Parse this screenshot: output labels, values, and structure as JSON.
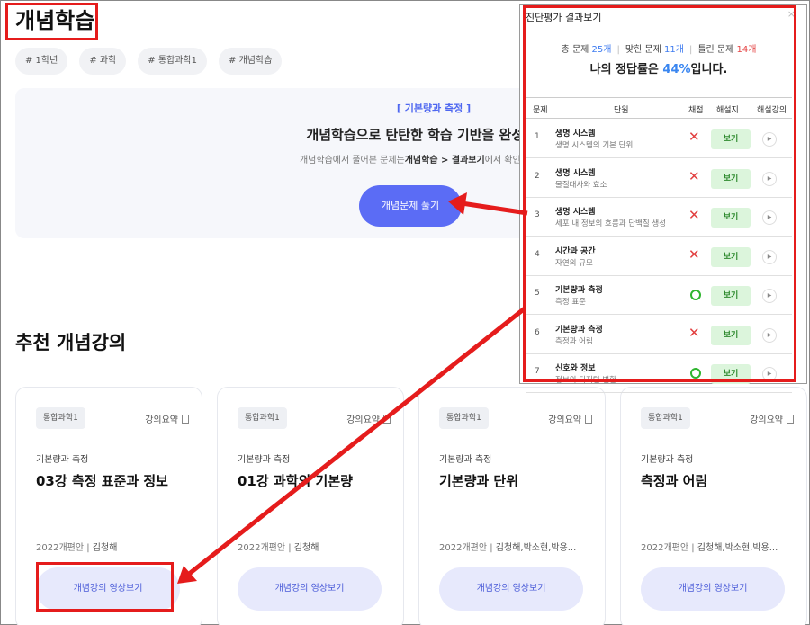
{
  "page": {
    "title": "개념학습"
  },
  "tags": [
    "# 1학년",
    "# 과학",
    "# 통합과학1",
    "# 개념학습"
  ],
  "hero": {
    "category": "[ 기본량과 측정 ]",
    "headline": "개념학습으로 탄탄한 학습 기반을 완성하세요",
    "sub_prefix": "개념학습에서 풀어본 문제는",
    "sub_bold": "개념학습 > 결과보기",
    "sub_suffix": "에서 확인 가능합니다.",
    "button": "개념문제 풀기"
  },
  "section": {
    "title": "추천 개념강의"
  },
  "cards": [
    {
      "chip": "통합과학1",
      "summary": "강의요약",
      "category": "기본량과 측정",
      "title": "03강 측정 표준과 정보",
      "edition": "2022개편안",
      "author": "김청해",
      "button": "개념강의 영상보기"
    },
    {
      "chip": "통합과학1",
      "summary": "강의요약",
      "category": "기본량과 측정",
      "title": "01강 과학의 기본량",
      "edition": "2022개편안",
      "author": "김청해",
      "button": "개념강의 영상보기"
    },
    {
      "chip": "통합과학1",
      "summary": "강의요약",
      "category": "기본량과 측정",
      "title": "기본량과 단위",
      "edition": "2022개편안",
      "author": "김청해,박소현,박용...",
      "button": "개념강의 영상보기"
    },
    {
      "chip": "통합과학1",
      "summary": "강의요약",
      "category": "기본량과 측정",
      "title": "측정과 어림",
      "edition": "2022개편안",
      "author": "김청해,박소현,박용...",
      "button": "개념강의 영상보기"
    }
  ],
  "panel": {
    "title": "진단평가 결과보기",
    "close": "×",
    "total_label": "총 문제",
    "total_value": "25개",
    "correct_label": "맞힌 문제",
    "correct_value": "11개",
    "wrong_label": "틀린 문제",
    "wrong_value": "14개",
    "rate_prefix": "나의 정답률은 ",
    "rate_value": "44%",
    "rate_suffix": "입니다.",
    "headers": [
      "문제",
      "단원",
      "채점",
      "해설지",
      "해설강의"
    ],
    "rows": [
      {
        "num": "1",
        "unit": "생명 시스템",
        "sub": "생명 시스템의 기본 단위",
        "result": "wrong",
        "button": "보기"
      },
      {
        "num": "2",
        "unit": "생명 시스템",
        "sub": "물질대사와 효소",
        "result": "wrong",
        "button": "보기"
      },
      {
        "num": "3",
        "unit": "생명 시스템",
        "sub": "세포 내 정보의 흐름과 단백질 생성",
        "result": "wrong",
        "button": "보기"
      },
      {
        "num": "4",
        "unit": "시간과 공간",
        "sub": "자연의 규모",
        "result": "wrong",
        "button": "보기"
      },
      {
        "num": "5",
        "unit": "기본량과 측정",
        "sub": "측정 표준",
        "result": "correct",
        "button": "보기"
      },
      {
        "num": "6",
        "unit": "기본량과 측정",
        "sub": "측정과 어림",
        "result": "wrong",
        "button": "보기"
      },
      {
        "num": "7",
        "unit": "신호와 정보",
        "sub": "정보의 디지털 변환",
        "result": "correct",
        "button": "보기"
      }
    ]
  },
  "colors": {
    "accent": "#5b6cf5",
    "highlight": "#e51c1c",
    "correct": "#2fb52f",
    "wrong": "#e24040"
  }
}
